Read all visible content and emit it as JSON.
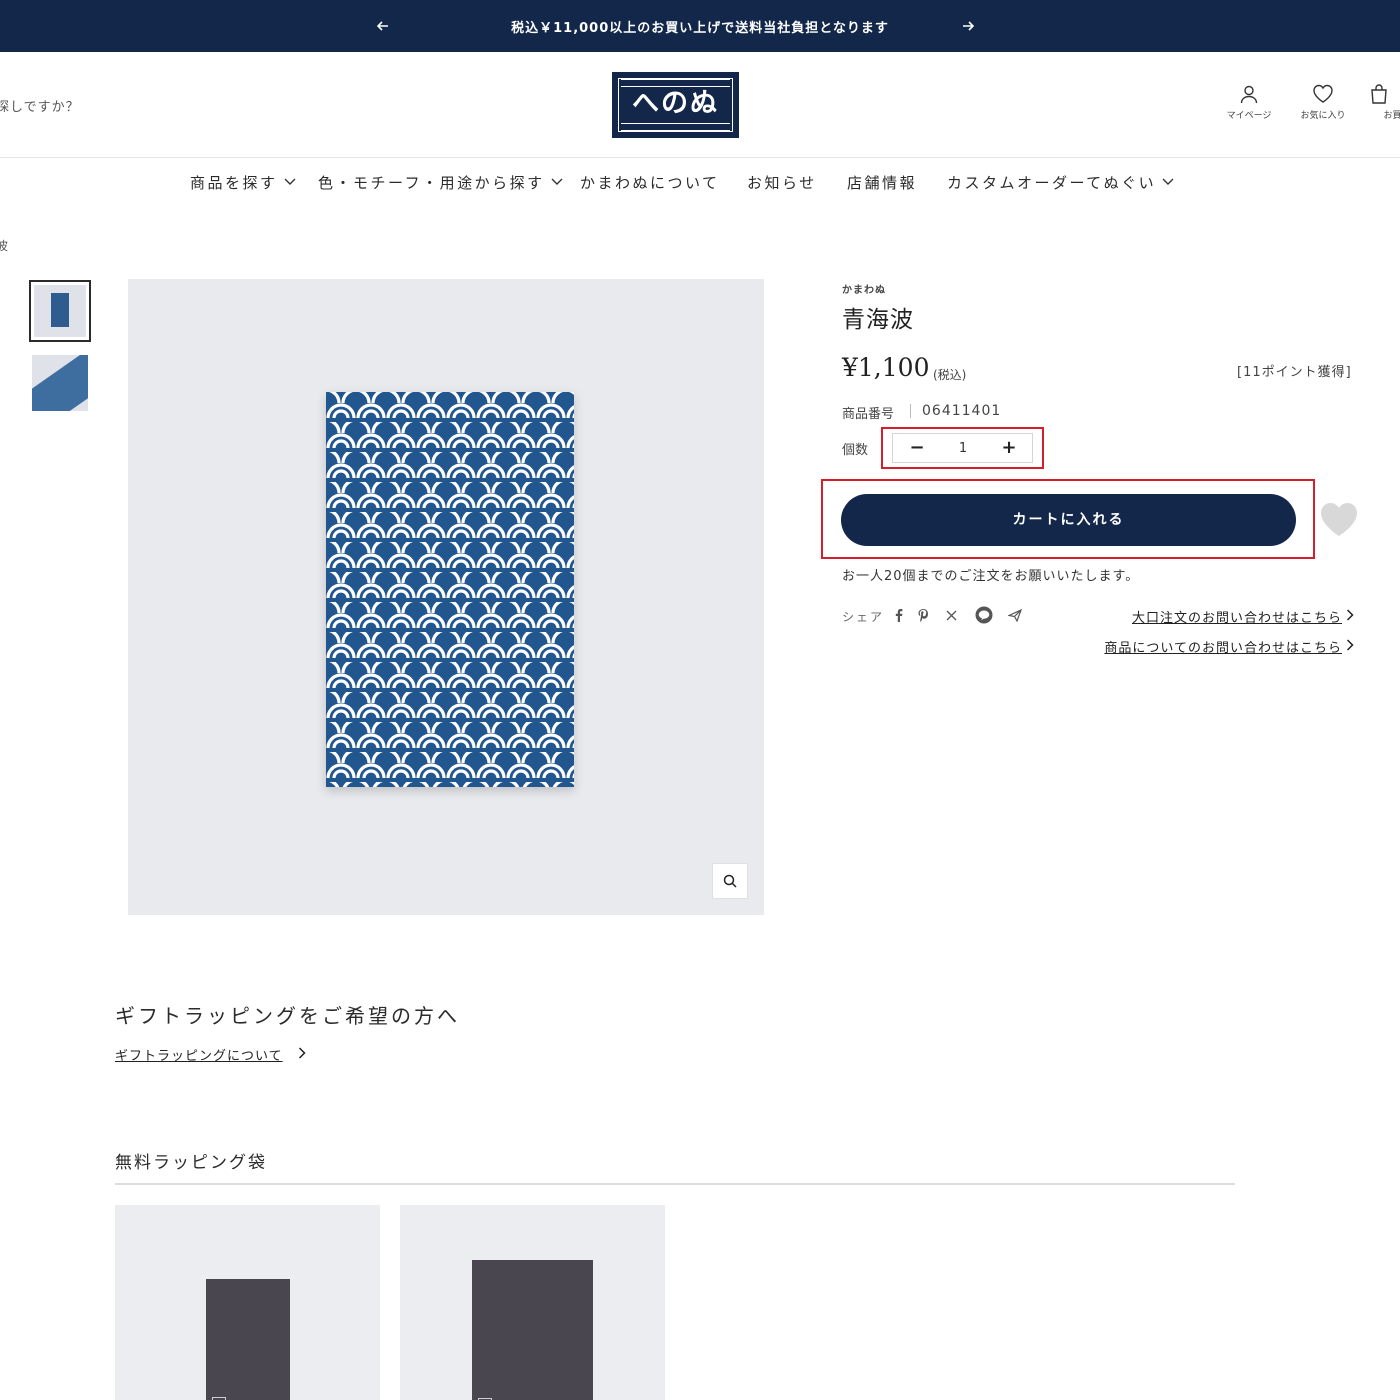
{
  "announcement": {
    "message": "税込￥11,000以上のお買い上げで送料当社負担となります"
  },
  "header": {
    "search_placeholder": "探しですか？",
    "logo_text": "へのぬ",
    "icons": {
      "mypage": "マイページ",
      "favorites": "お気に入り",
      "cart": "お買い"
    }
  },
  "nav": {
    "items": [
      {
        "label": "商品を探す",
        "dropdown": true
      },
      {
        "label": "色・モチーフ・用途から探す",
        "dropdown": true
      },
      {
        "label": "かまわぬについて",
        "dropdown": false
      },
      {
        "label": "お知らせ",
        "dropdown": false
      },
      {
        "label": "店舗情報",
        "dropdown": false
      },
      {
        "label": "カスタムオーダーてぬぐい",
        "dropdown": true
      }
    ]
  },
  "breadcrumb": {
    "current": "波"
  },
  "product": {
    "vendor": "かまわぬ",
    "title": "青海波",
    "price": "¥1,100",
    "tax_label": "(税込)",
    "points": "[11ポイント獲得]",
    "sku_label": "商品番号",
    "sku": "06411401",
    "qty_label": "個数",
    "qty_value": "1",
    "add_to_cart": "カートに入れる",
    "limit_note": "お一人20個までのご注文をお願いいたします。",
    "share_label": "シェア",
    "bulk_inquiry": "大口注文のお問い合わせはこちら",
    "product_inquiry": "商品についてのお問い合わせはこちら"
  },
  "colors": {
    "navy": "#13274a",
    "pattern_blue": "#22568f",
    "highlight_red": "#d61f2c"
  },
  "gift": {
    "title": "ギフトラッピングをご希望の方へ",
    "link": "ギフトラッピングについて"
  },
  "wrapping": {
    "title": "無料ラッピング袋"
  }
}
